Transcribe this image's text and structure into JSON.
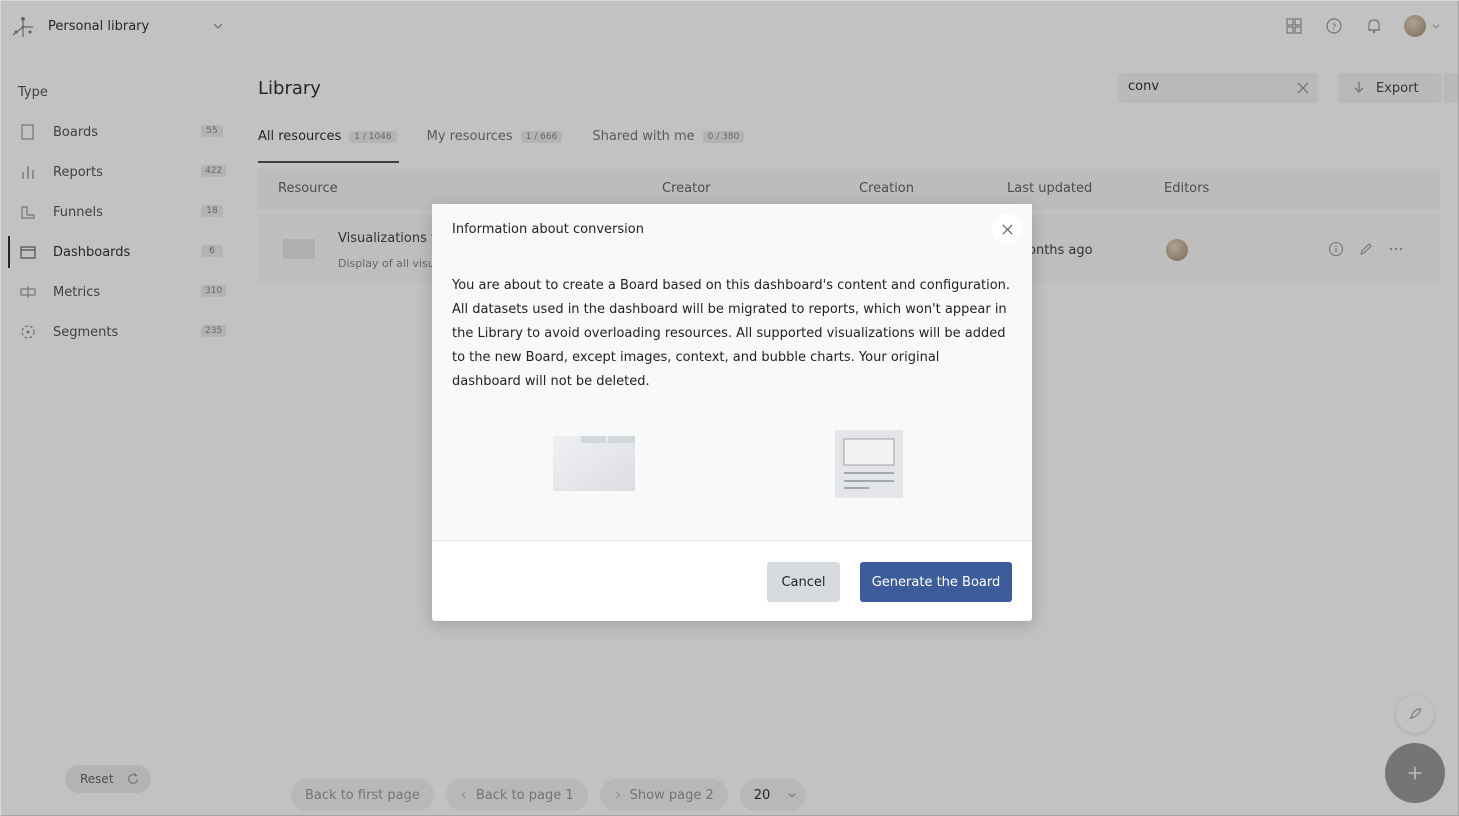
{
  "topbar": {
    "workspace": "Personal library",
    "icons": [
      "apps-grid-icon",
      "help-icon",
      "bell-icon",
      "avatar"
    ]
  },
  "sidebar": {
    "title": "Type",
    "items": [
      {
        "label": "Boards",
        "count": "55",
        "icon": "board-icon"
      },
      {
        "label": "Reports",
        "count": "422",
        "icon": "bar-chart-icon"
      },
      {
        "label": "Funnels",
        "count": "18",
        "icon": "funnel-icon"
      },
      {
        "label": "Dashboards",
        "count": "6",
        "icon": "folder-icon"
      },
      {
        "label": "Metrics",
        "count": "310",
        "icon": "metric-icon"
      },
      {
        "label": "Segments",
        "count": "235",
        "icon": "segment-icon"
      }
    ],
    "reset_label": "Reset"
  },
  "main": {
    "title": "Library",
    "search_value": "conv",
    "export_label": "Export",
    "tabs": [
      {
        "label": "All resources",
        "count": "1 / 1046"
      },
      {
        "label": "My resources",
        "count": "1 / 666"
      },
      {
        "label": "Shared with me",
        "count": "0 / 380"
      }
    ],
    "columns": [
      "Resource",
      "Creator",
      "Creation",
      "Last updated",
      "Editors"
    ],
    "rows": [
      {
        "title": "Visualizations f",
        "desc": "Display of all visu",
        "updated": "onths ago"
      }
    ],
    "pager": {
      "first": "Back to first page",
      "prev": "Back to page 1",
      "next": "Show page 2",
      "size": "20"
    }
  },
  "modal": {
    "title": "Information about conversion",
    "body": "You are about to create a Board based on this dashboard's content and configuration. All datasets used in the dashboard will be migrated to reports, which won't appear in the Library to avoid overloading resources. All supported visualizations will be added to the new Board, except images, context, and bubble charts. Your original dashboard will not be deleted.",
    "cancel_label": "Cancel",
    "confirm_label": "Generate the Board"
  },
  "colors": {
    "primary": "#3d5d9a",
    "cancel_bg": "#d7dadf",
    "overlay": "rgba(0,0,0,0.24)"
  }
}
